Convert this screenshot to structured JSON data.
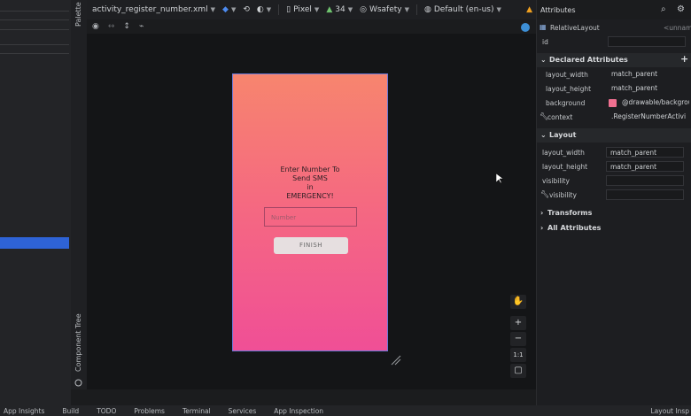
{
  "toolbar": {
    "file_name": "activity_register_number.xml",
    "device": "Pixel",
    "api_level": "34",
    "theme": "Wsafety",
    "locale": "Default (en-us)"
  },
  "side_tabs": {
    "palette": "Palette",
    "component_tree": "Component Tree"
  },
  "phone_preview": {
    "title_lines": [
      "Enter Number To",
      "Send SMS",
      "in",
      "EMERGENCY!"
    ],
    "input_placeholder": "Number",
    "button_label": "FINISH",
    "gradient_colors": [
      "#f7856e",
      "#f04f96"
    ]
  },
  "zoom_controls": {
    "plus": "+",
    "minus": "−",
    "one_to_one": "1:1"
  },
  "attributes_panel": {
    "title": "Attributes",
    "component": "RelativeLayout",
    "component_name": "<unnamed>",
    "id_label": "id",
    "declared": {
      "title": "Declared Attributes",
      "rows": [
        {
          "key": "layout_width",
          "value": "match_parent"
        },
        {
          "key": "layout_height",
          "value": "match_parent"
        },
        {
          "key": "background",
          "value": "@drawable/background"
        },
        {
          "key": "context",
          "value": ".RegisterNumberActivity"
        }
      ]
    },
    "layout": {
      "title": "Layout",
      "rows": [
        {
          "key": "layout_width",
          "value": "match_parent"
        },
        {
          "key": "layout_height",
          "value": "match_parent"
        },
        {
          "key": "visibility",
          "value": ""
        },
        {
          "key": "visibility",
          "value": ""
        }
      ]
    },
    "transforms": "Transforms",
    "all_attributes": "All Attributes"
  },
  "bottom_bar": [
    "App Insights",
    "Build",
    "TODO",
    "Problems",
    "Terminal",
    "Services",
    "App Inspection",
    "Layout Insp"
  ],
  "colors": {
    "accent_blue": "#2e63d6",
    "warning": "#f0a020"
  }
}
